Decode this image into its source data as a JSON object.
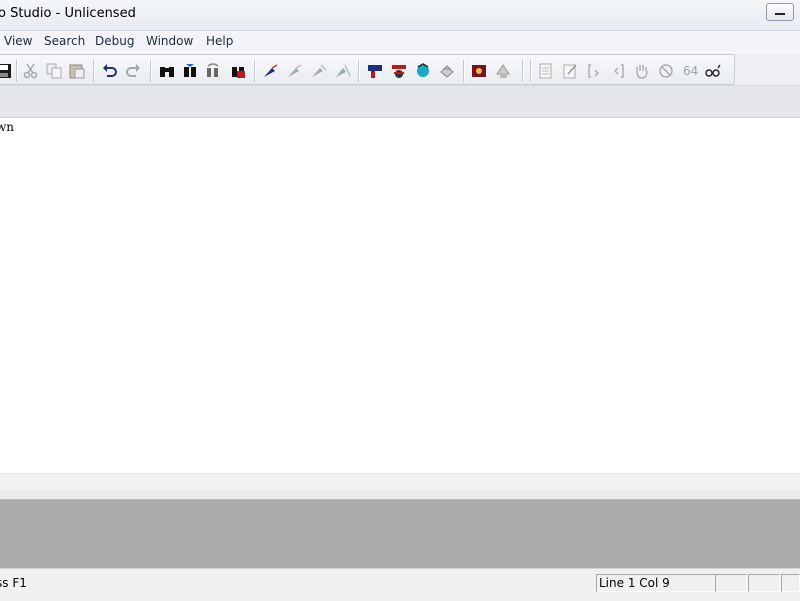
{
  "window": {
    "title": "o Studio - Unlicensed"
  },
  "menu": [
    "View",
    "Search",
    "Debug",
    "Window",
    "Help"
  ],
  "toolbar": {
    "buttons": [
      "save-icon",
      "cut-icon",
      "copy-icon",
      "paste-icon",
      "undo-icon",
      "redo-icon",
      "find-icon",
      "find-next-icon",
      "replace-icon",
      "find-in-files-icon",
      "compile-icon",
      "build-icon",
      "rebuild-icon",
      "clean-icon",
      "run-icon",
      "debug-icon",
      "step-icon",
      "breakpoint-icon",
      "profile-icon",
      "deploy-icon",
      "page-icon",
      "edit-page-icon",
      "bracket-in-icon",
      "bracket-out-icon",
      "hand-icon",
      "stop-icon",
      "watch-icon"
    ],
    "number_label": "64"
  },
  "editor": {
    "line1": "wn"
  },
  "status": {
    "help_text": "ss F1",
    "position": "Line 1 Col 9"
  }
}
